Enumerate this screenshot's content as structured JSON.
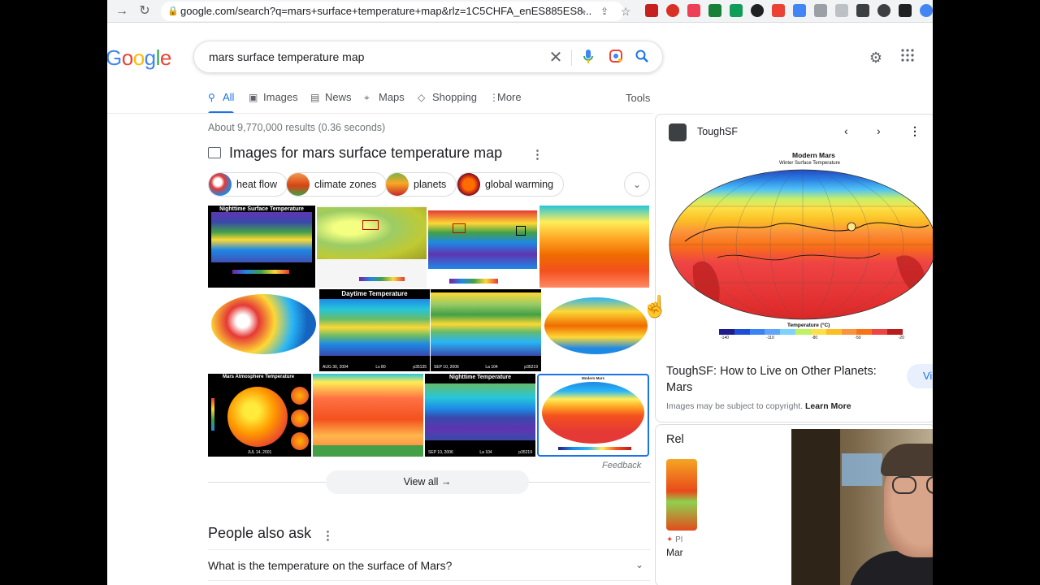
{
  "browser": {
    "url": "google.com/search?q=mars+surface+temperature+map&rlz=1C5CHFA_enES885ES8..."
  },
  "header": {
    "logo": "Google",
    "query": "mars surface temperature map"
  },
  "tabs": [
    {
      "label": "All",
      "icon": "search-icon",
      "active": true
    },
    {
      "label": "Images",
      "icon": "image-icon"
    },
    {
      "label": "News",
      "icon": "news-icon"
    },
    {
      "label": "Maps",
      "icon": "map-pin-icon"
    },
    {
      "label": "Shopping",
      "icon": "tag-icon"
    },
    {
      "label": "More",
      "icon": "dots-vertical-icon"
    }
  ],
  "tools_label": "Tools",
  "stats": "About 9,770,000 results (0.36 seconds)",
  "images": {
    "heading": "Images for mars surface temperature map",
    "chips": [
      "heat flow",
      "climate zones",
      "planets",
      "global warming"
    ],
    "tile_captions": {
      "t1": "Nighttime Surface Temperature",
      "t6": "Daytime Temperature",
      "t6_foot_a": "AUG 30, 2004",
      "t6_foot_b": "Ls 80",
      "t6_foot_c": "p35135",
      "t7_foot_a": "SEP 10, 2006",
      "t7_foot_b": "La 104",
      "t7_foot_c": "p35219",
      "t9": "Mars Atmosphere Temperature",
      "t9_foot": "JUL 14, 2001",
      "t11": "Nighttime Temperature",
      "t11_foot_a": "SEP 10, 2006",
      "t11_foot_b": "La 104",
      "t11_foot_c": "p35219",
      "t12": "Modern Mars"
    },
    "feedback": "Feedback",
    "view_all": "View all"
  },
  "people_also_ask": {
    "title": "People also ask",
    "questions": [
      "What is the temperature on the surface of Mars?"
    ]
  },
  "panel": {
    "source": "ToughSF",
    "map_title": "Modern Mars",
    "map_subtitle": "Winter Surface Temperature",
    "legend_label": "Temperature (°C)",
    "legend_ticks": [
      "-140",
      "-110",
      "-80",
      "-50",
      "-20"
    ],
    "title": "ToughSF: How to Live on Other Planets: Mars",
    "visit": "Vis",
    "copyright": "Images may be subject to copyright.",
    "learn_more": "Learn More"
  },
  "related": {
    "title": "Rel",
    "source": "Pl",
    "name": "Mar"
  },
  "colors": {
    "accent": "#1a73e8",
    "text": "#202124",
    "muted": "#70757a"
  }
}
